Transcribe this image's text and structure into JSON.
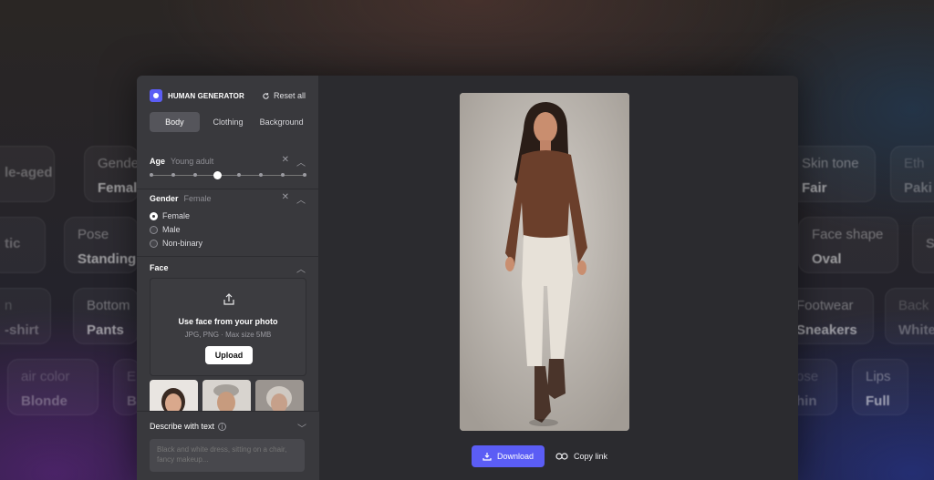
{
  "background_chips": [
    {
      "key": "",
      "value": "le-aged",
      "dim": true
    },
    {
      "key": "Gender",
      "value": "Female",
      "dim": false
    },
    {
      "key": "",
      "value": "tic",
      "dim": true
    },
    {
      "key": "Pose",
      "value": "Standing",
      "dim": false
    },
    {
      "key": "n",
      "value": "-shirt",
      "dim": true
    },
    {
      "key": "Bottom",
      "value": "Pants",
      "dim": false
    },
    {
      "key": "air color",
      "value": "Blonde",
      "dim": true
    },
    {
      "key": "E",
      "value": "B",
      "dim": true
    },
    {
      "key": "Skin tone",
      "value": "Fair",
      "dim": false
    },
    {
      "key": "Eth",
      "value": "Paki",
      "dim": true
    },
    {
      "key": "Face shape",
      "value": "Oval",
      "dim": false
    },
    {
      "key": "",
      "value": "S",
      "dim": true
    },
    {
      "key": "Footwear",
      "value": "Sneakers",
      "dim": false
    },
    {
      "key": "Back",
      "value": "White",
      "dim": true
    },
    {
      "key": "ose",
      "value": "hin",
      "dim": true
    },
    {
      "key": "Lips",
      "value": "Full",
      "dim": false
    }
  ],
  "app": {
    "brand": "HUMAN GENERATOR",
    "reset_label": "Reset all",
    "tabs": [
      "Body",
      "Clothing",
      "Background"
    ],
    "active_tab": "Body",
    "age": {
      "title": "Age",
      "value": "Young adult",
      "steps": 8,
      "selected_index": 3
    },
    "gender": {
      "title": "Gender",
      "value": "Female",
      "options": [
        "Female",
        "Male",
        "Non-binary"
      ],
      "selected": "Female"
    },
    "face": {
      "title": "Face",
      "upload_title": "Use face from your photo",
      "upload_hint": "JPG, PNG · Max size 5MB",
      "upload_button": "Upload"
    },
    "describe": {
      "title": "Describe with text",
      "placeholder": "Black and white dress, sitting on a chair, fancy makeup..."
    },
    "actions": {
      "download": "Download",
      "copy_link": "Copy link"
    }
  },
  "colors": {
    "accent": "#5b5df5",
    "panel": "#39393d",
    "window": "#2b2b2f"
  },
  "icons": [
    "reset-icon",
    "close-icon",
    "chevron-up-icon",
    "chevron-down-icon",
    "upload-icon",
    "info-icon",
    "download-icon",
    "link-icon"
  ]
}
